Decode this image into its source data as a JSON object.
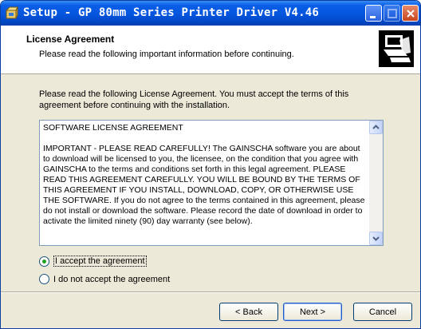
{
  "window": {
    "title": "Setup - GP 80mm Series Printer Driver V4.46",
    "icon": "setup-box-icon"
  },
  "header": {
    "title": "License Agreement",
    "subtitle": "Please read the following important information before continuing."
  },
  "intro": "Please read the following License Agreement. You must accept the terms of this agreement before continuing with the installation.",
  "license": {
    "text": "SOFTWARE LICENSE AGREEMENT\n\nIMPORTANT - PLEASE READ CAREFULLY! The GAINSCHA software you are about to download will be licensed to you, the licensee, on the condition that you agree with GAINSCHA to the terms and conditions set forth in this legal agreement. PLEASE READ THIS AGREEMENT CAREFULLY. YOU WILL BE BOUND BY THE TERMS OF THIS AGREEMENT IF YOU INSTALL, DOWNLOAD, COPY, OR OTHERWISE USE THE SOFTWARE. If you do not agree to the terms contained in this agreement, please do not install or download the software. Please record the date of download in order to activate the limited ninety (90) day warranty (see below)."
  },
  "options": {
    "accept": "I accept the agreement",
    "decline": "I do not accept the agreement",
    "selected": "accept"
  },
  "buttons": {
    "back": "< Back",
    "next": "Next >",
    "cancel": "Cancel"
  },
  "colors": {
    "titlebar": "#0555de",
    "radio_selected": "#21a121"
  }
}
